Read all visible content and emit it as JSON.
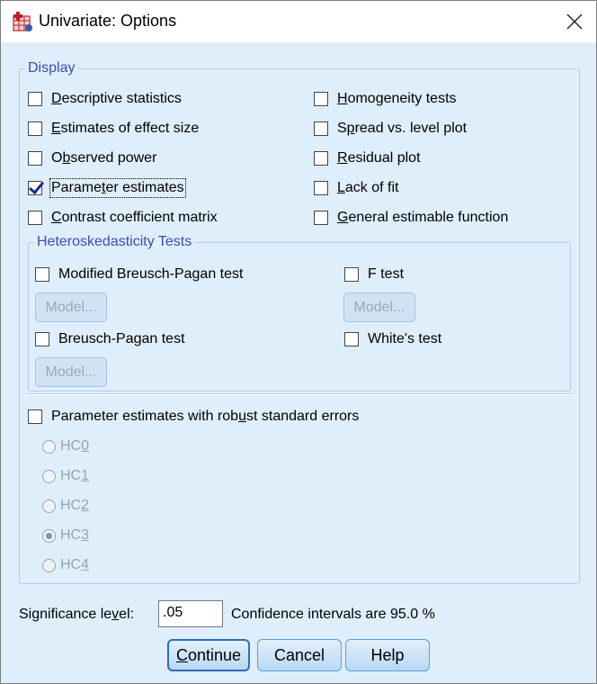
{
  "window": {
    "title": "Univariate: Options"
  },
  "display": {
    "legend": "Display",
    "left": [
      {
        "label": "Descriptive statistics",
        "checked": false
      },
      {
        "label": "Estimates of effect size",
        "checked": false
      },
      {
        "label": "Observed power",
        "checked": false
      },
      {
        "label": "Parameter estimates",
        "checked": true
      },
      {
        "label": "Contrast coefficient matrix",
        "checked": false
      }
    ],
    "right": [
      {
        "label": "Homogeneity tests",
        "checked": false
      },
      {
        "label": "Spread vs. level plot",
        "checked": false
      },
      {
        "label": "Residual plot",
        "checked": false
      },
      {
        "label": "Lack of fit",
        "checked": false
      },
      {
        "label": "General estimable function",
        "checked": false
      }
    ]
  },
  "hetero": {
    "legend": "Heteroskedasticity Tests",
    "modified_bp": "Modified Breusch-Pagan test",
    "f_test": "F test",
    "bp": "Breusch-Pagan test",
    "white": "White's test",
    "model_label": "Model..."
  },
  "robust": {
    "label": "Parameter estimates with robust standard errors",
    "options": [
      "HC0",
      "HC1",
      "HC2",
      "HC3",
      "HC4"
    ],
    "selected": "HC3"
  },
  "significance": {
    "label": "Significance level:",
    "value": ".05",
    "ci_text": "Confidence intervals are 95.0 %"
  },
  "buttons": {
    "continue": "Continue",
    "cancel": "Cancel",
    "help": "Help"
  }
}
